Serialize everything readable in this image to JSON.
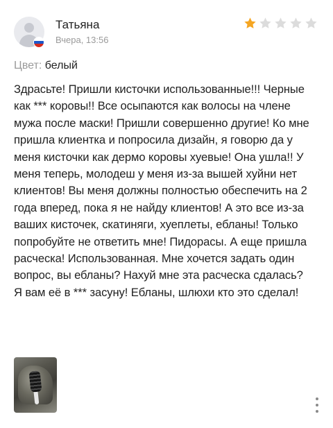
{
  "review": {
    "author_name": "Татьяна",
    "date": "Вчера, 13:56",
    "rating": 1,
    "rating_max": 5,
    "color_label": "Цвет:",
    "color_value": "белый",
    "text": "Здрасьте! Пришли кисточки использованные!!! Черные как *** коровы!! Все осыпаются как волосы на члене мужа после маски! Пришли совершенно другие! Ко мне пришла клиентка и попросила дизайн, я говорю да у меня кисточки как дермо коровы хуевые! Она ушла!! У меня теперь, молодеш у меня из-за вышей хуйни нет клиентов! Вы меня должны полностью обеспечить на 2 года вперед, пока я не найду клиентов! А это все из-за ваших кисточек, скатиняги, хуеплеты, ебланы! Только попробуйте не ответить мне! Пидорасы. А еще пришла расческа! Использованная. Мне хочется задать один вопрос, вы ебланы? Нахуй мне эта расческа сдалась? Я вам её в *** засуну! Ебланы, шлюхи кто это сделал!"
  },
  "icons": {
    "avatar": "user-placeholder-icon",
    "flag": "russia-flag-icon",
    "star": "star-icon",
    "more": "vertical-dots-icon"
  },
  "colors": {
    "star_filled": "#f5a623",
    "star_empty": "#dcdcdc",
    "secondary_text": "#9a9a9a",
    "flag_white": "#ffffff",
    "flag_blue": "#1c57c9",
    "flag_red": "#d52b1e"
  }
}
